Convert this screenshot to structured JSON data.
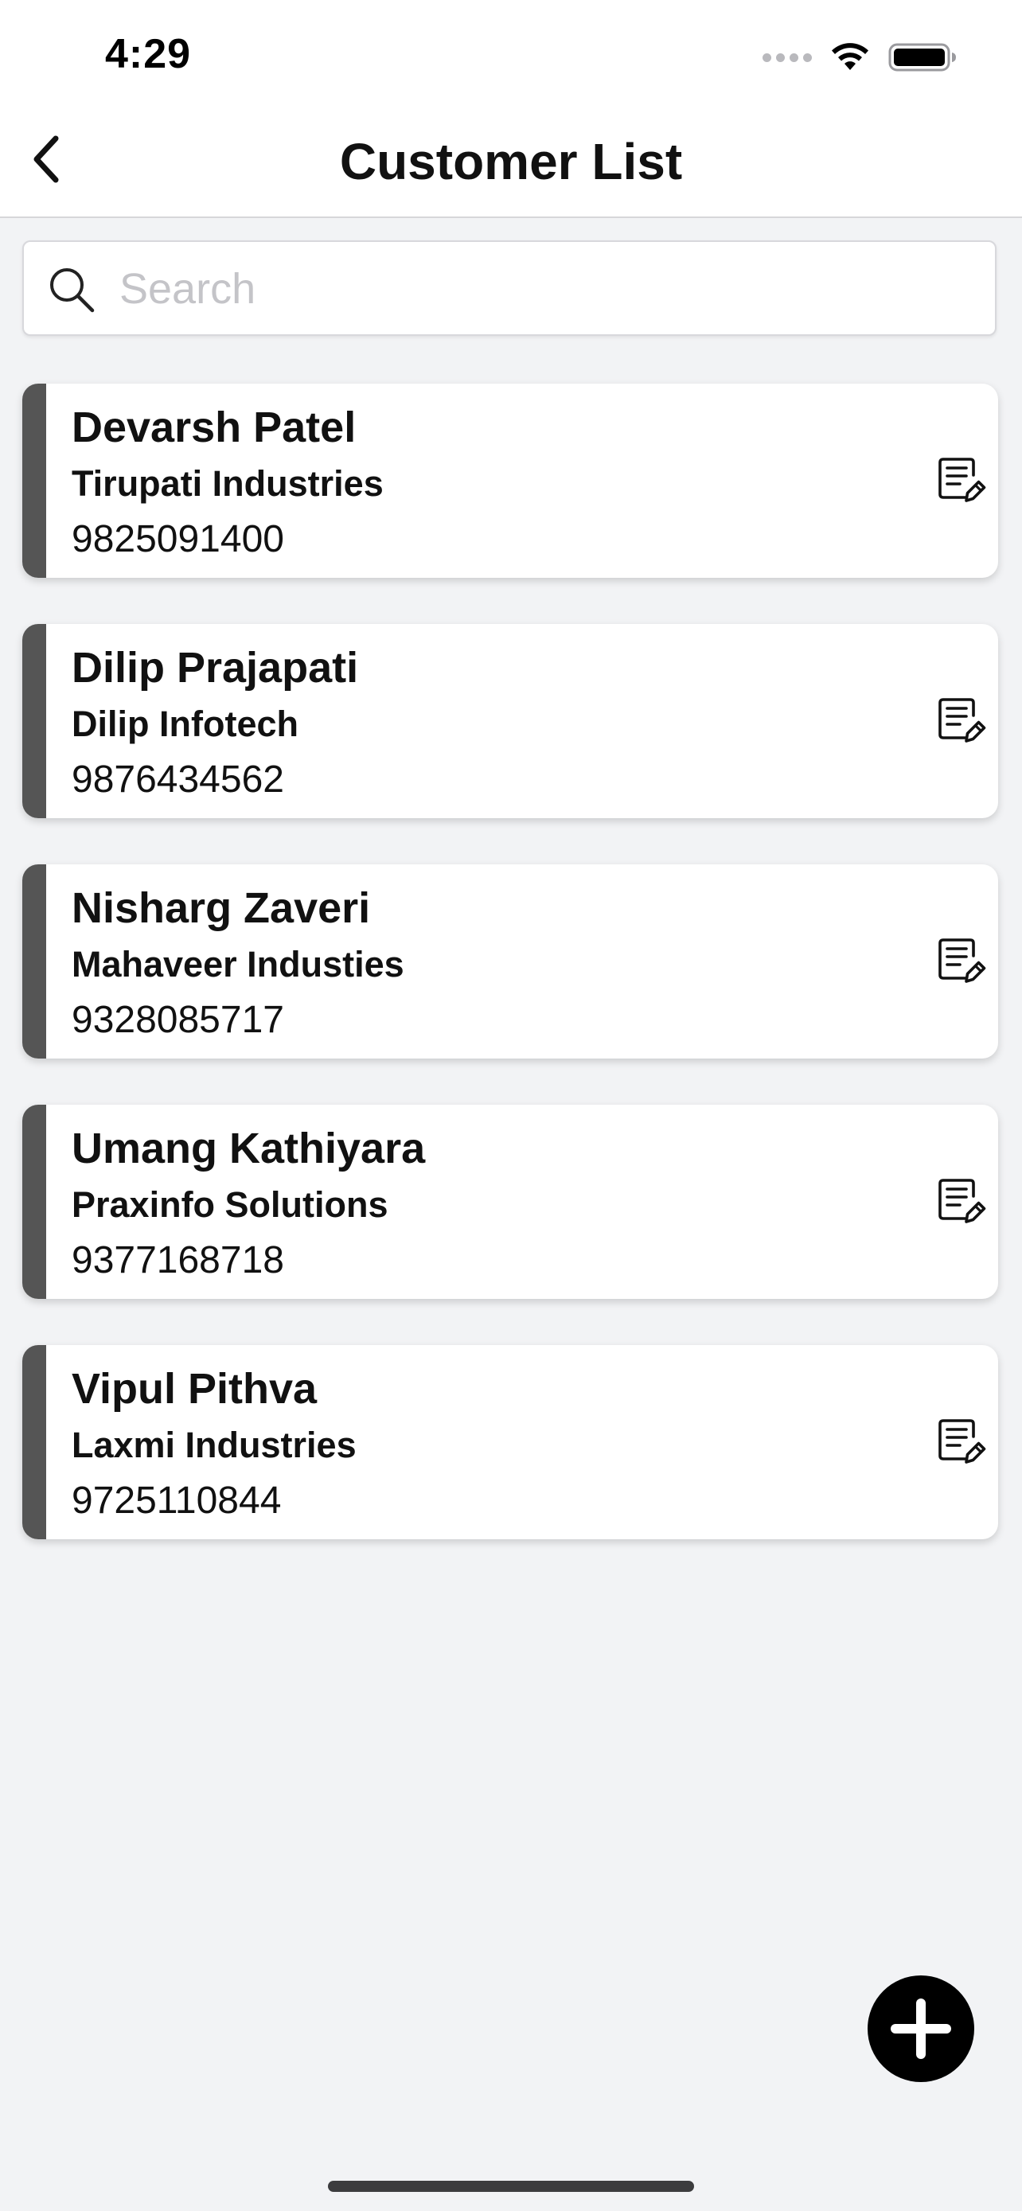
{
  "status_bar": {
    "time": "4:29"
  },
  "nav": {
    "title": "Customer List",
    "back_icon": "chevron-left-icon"
  },
  "search": {
    "placeholder": "Search",
    "value": "",
    "icon": "search-icon"
  },
  "colors": {
    "accent_bar": "#555555",
    "fab_background": "#000000",
    "background": "#f2f3f5"
  },
  "customers": [
    {
      "name": "Devarsh Patel",
      "company": "Tirupati Industries",
      "phone": "9825091400"
    },
    {
      "name": "Dilip Prajapati",
      "company": "Dilip Infotech",
      "phone": "9876434562"
    },
    {
      "name": "Nisharg Zaveri",
      "company": "Mahaveer Industies",
      "phone": "9328085717"
    },
    {
      "name": "Umang Kathiyara",
      "company": "Praxinfo Solutions",
      "phone": "9377168718"
    },
    {
      "name": "Vipul Pithva",
      "company": "Laxmi Industries",
      "phone": "9725110844"
    }
  ],
  "card_action_icon": "edit-note-icon",
  "fab_icon": "plus-icon"
}
